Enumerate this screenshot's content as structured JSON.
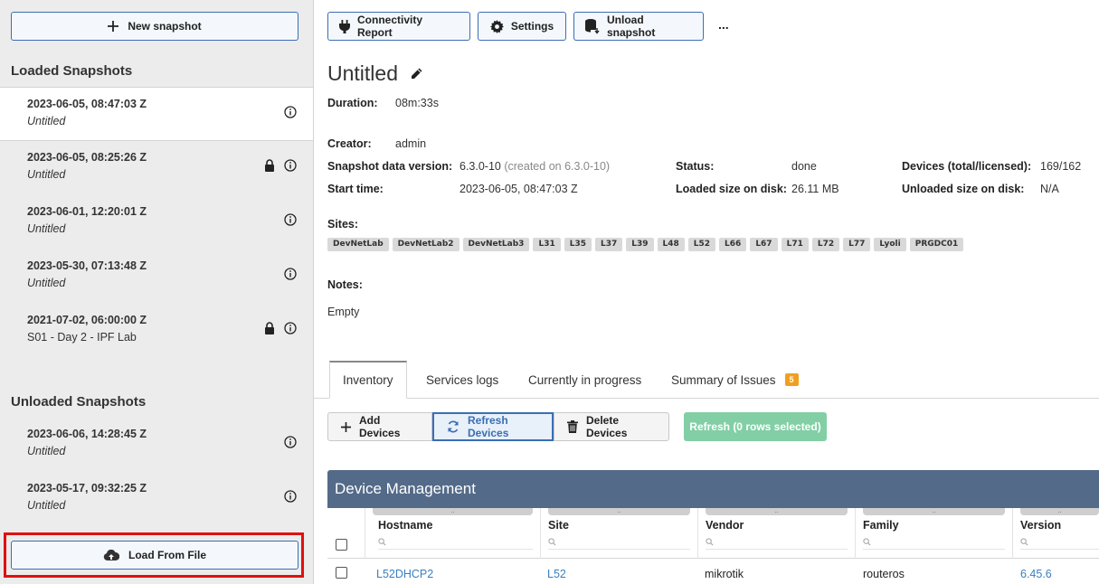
{
  "sidebar": {
    "new_snapshot": "New snapshot",
    "loaded_heading": "Loaded Snapshots",
    "loaded": [
      {
        "date": "2023-06-05, 08:47:03 Z",
        "name": "Untitled"
      },
      {
        "date": "2023-06-05, 08:25:26 Z",
        "name": "Untitled"
      },
      {
        "date": "2023-06-01, 12:20:01 Z",
        "name": "Untitled"
      },
      {
        "date": "2023-05-30, 07:13:48 Z",
        "name": "Untitled"
      },
      {
        "date": "2021-07-02, 06:00:00 Z",
        "name": "S01 - Day 2 - IPF Lab"
      }
    ],
    "unloaded_heading": "Unloaded Snapshots",
    "unloaded": [
      {
        "date": "2023-06-06, 14:28:45 Z",
        "name": "Untitled"
      },
      {
        "date": "2023-05-17, 09:32:25 Z",
        "name": "Untitled"
      }
    ],
    "load_from_file": "Load From File"
  },
  "toolbar": {
    "connectivity_report": "Connectivity Report",
    "settings": "Settings",
    "unload_snapshot": "Unload snapshot",
    "more": "..."
  },
  "snapshot": {
    "title": "Untitled",
    "duration_label": "Duration:",
    "duration": "08m:33s",
    "creator_label": "Creator:",
    "creator": "admin",
    "data_version_label": "Snapshot data version:",
    "data_version": "6.3.0-10",
    "data_version_created": "(created on 6.3.0-10)",
    "start_time_label": "Start time:",
    "start_time": "2023-06-05, 08:47:03 Z",
    "status_label": "Status:",
    "status": "done",
    "loaded_size_label": "Loaded size on disk:",
    "loaded_size": "26.11 MB",
    "devices_label": "Devices (total/licensed):",
    "devices": "169/162",
    "unloaded_size_label": "Unloaded size on disk:",
    "unloaded_size": "N/A",
    "sites_label": "Sites:",
    "sites": [
      "DevNetLab",
      "DevNetLab2",
      "DevNetLab3",
      "L31",
      "L35",
      "L37",
      "L39",
      "L48",
      "L52",
      "L66",
      "L67",
      "L71",
      "L72",
      "L77",
      "Lyoli",
      "PRGDC01"
    ],
    "notes_label": "Notes:",
    "notes": "Empty"
  },
  "tabs": {
    "inventory": "Inventory",
    "services_logs": "Services logs",
    "in_progress": "Currently in progress",
    "summary": "Summary of Issues",
    "summary_badge": "5"
  },
  "actions": {
    "add_devices": "Add Devices",
    "refresh_devices": "Refresh Devices",
    "delete_devices": "Delete Devices",
    "refresh_selected": "Refresh (0 rows selected)"
  },
  "table": {
    "title": "Device Management",
    "grip": "..",
    "columns": [
      "Hostname",
      "Site",
      "Vendor",
      "Family",
      "Version"
    ],
    "rows": [
      {
        "hostname": "L52DHCP2",
        "site": "L52",
        "vendor": "mikrotik",
        "family": "routeros",
        "version": "6.45.6"
      }
    ]
  },
  "colors": {
    "accent": "#3a6fb3",
    "header": "#546a89",
    "highlight_box": "#e01010",
    "badge": "#f0a020",
    "success_btn": "#82cfa5"
  }
}
